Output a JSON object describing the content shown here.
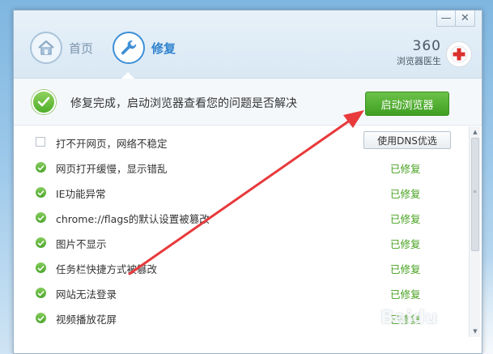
{
  "window": {
    "controls": {
      "minimize": "—",
      "close": "✕"
    }
  },
  "nav": {
    "home_label": "首页",
    "repair_label": "修复"
  },
  "brand": {
    "number": "360",
    "name": "浏览器医生"
  },
  "status": {
    "message": "修复完成，启动浏览器查看您的问题是否解决",
    "launch_button": "启动浏览器"
  },
  "items": [
    {
      "label": "打不开网页，网络不稳定",
      "state": "unchecked",
      "action": "使用DNS优选"
    },
    {
      "label": "网页打开缓慢，显示错乱",
      "state": "fixed",
      "status": "已修复"
    },
    {
      "label": "IE功能异常",
      "state": "fixed",
      "status": "已修复"
    },
    {
      "label": "chrome://flags的默认设置被篡改",
      "state": "fixed",
      "status": "已修复"
    },
    {
      "label": "图片不显示",
      "state": "fixed",
      "status": "已修复"
    },
    {
      "label": "任务栏快捷方式被篡改",
      "state": "fixed",
      "status": "已修复"
    },
    {
      "label": "网站无法登录",
      "state": "fixed",
      "status": "已修复"
    },
    {
      "label": "视频播放花屏",
      "state": "fixed",
      "status": "已修复"
    }
  ],
  "watermark": "Baidu",
  "colors": {
    "accent_blue": "#3e8fd6",
    "success_green": "#46a01f",
    "arrow_red": "#e8393b"
  }
}
